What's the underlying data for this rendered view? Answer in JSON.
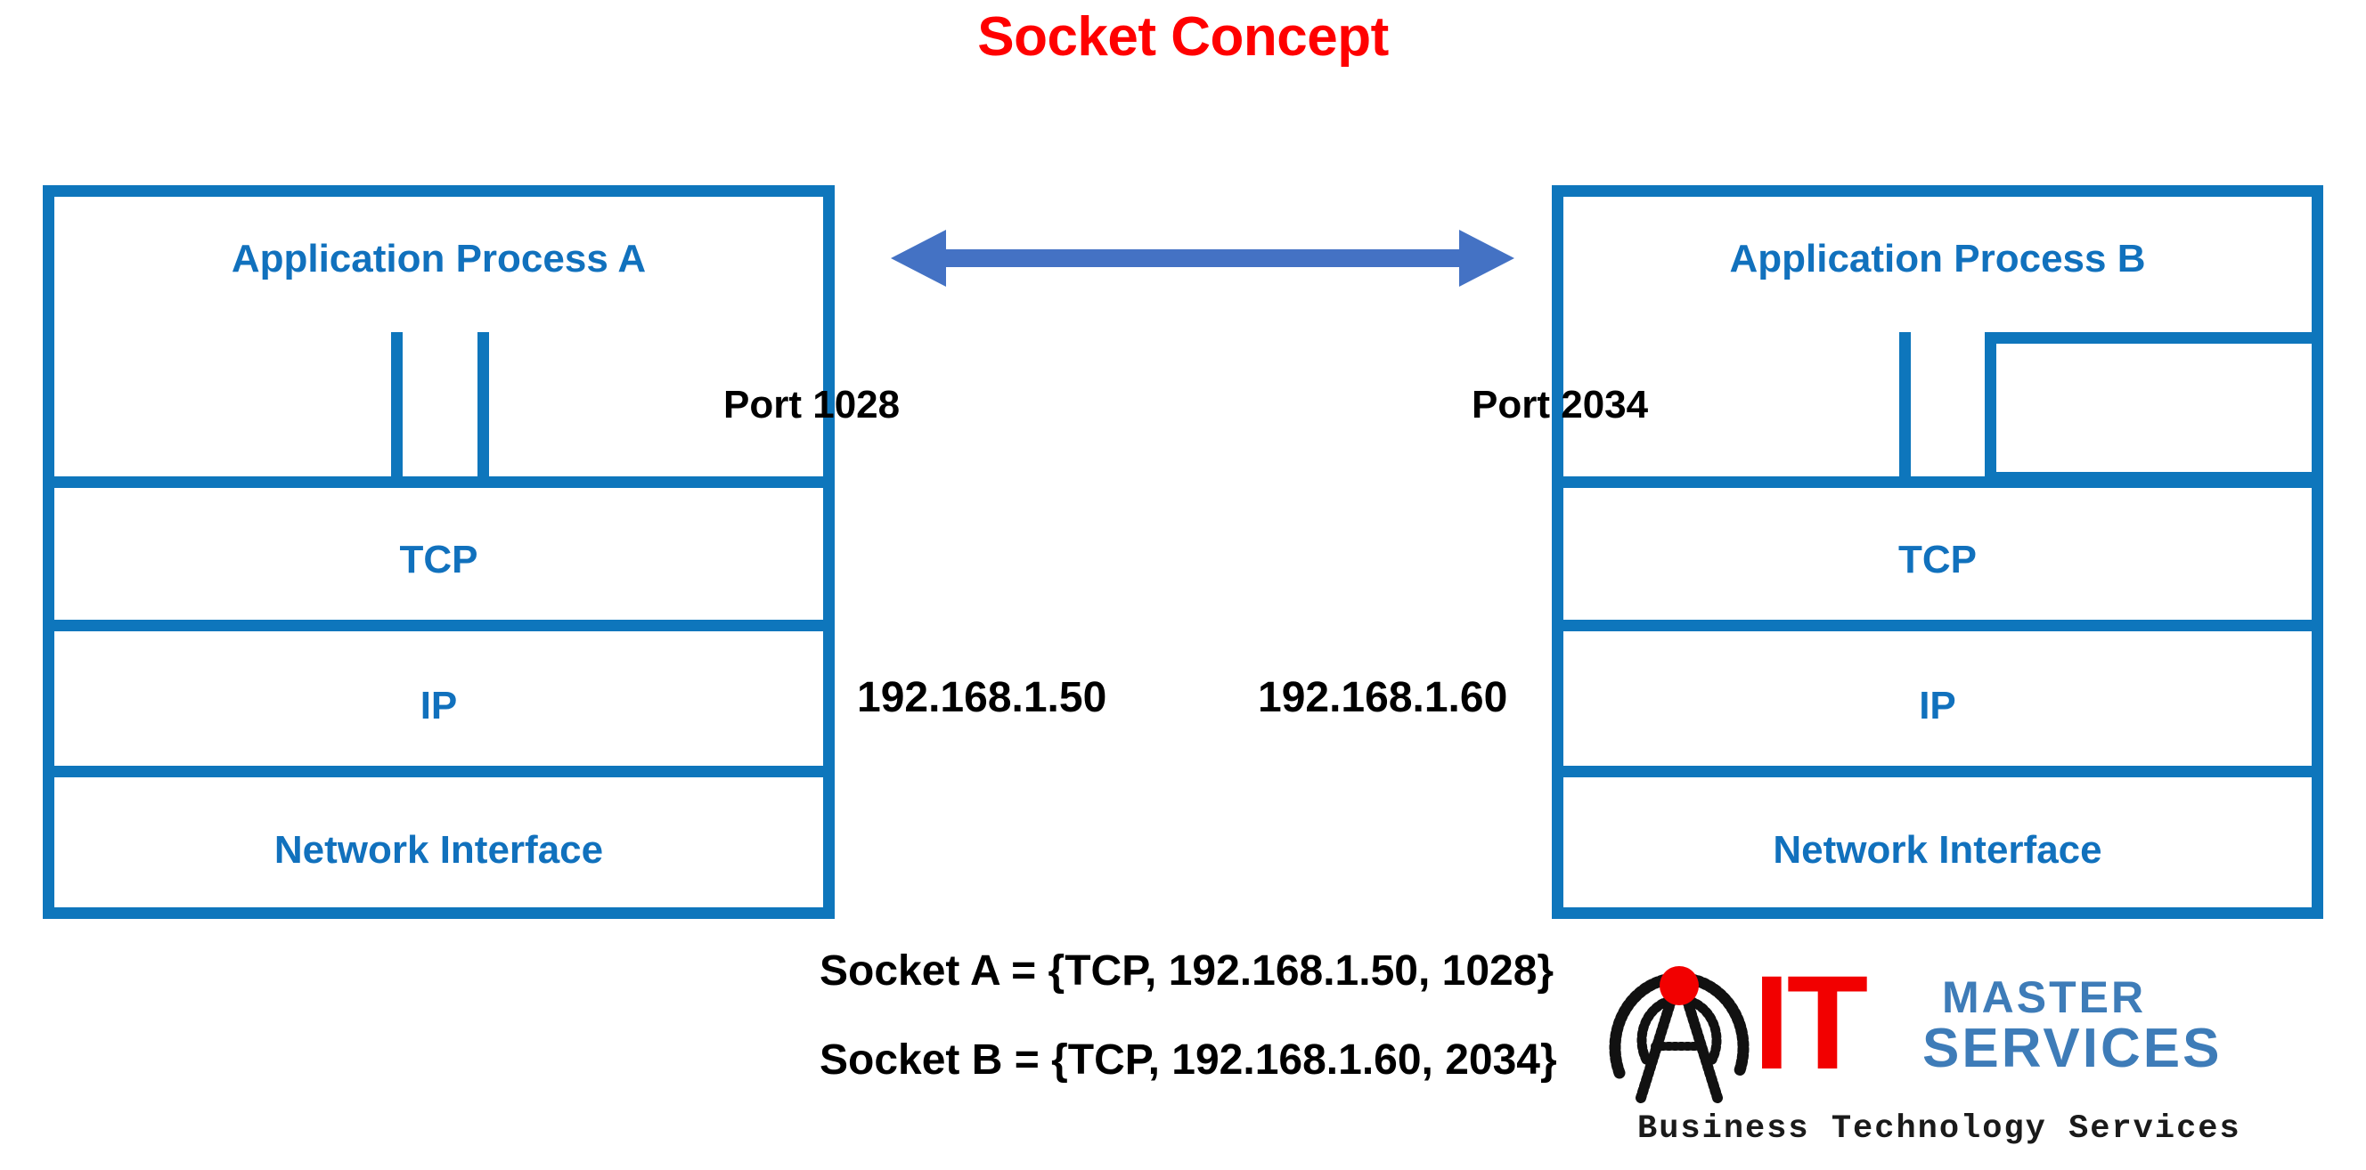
{
  "page": {
    "title": "Socket Concept",
    "title_color": "#FF0000",
    "background": "#ffffff"
  },
  "colors": {
    "box_blue": "#0E76BC",
    "label_blue": "#1171BD",
    "arrow_blue": "#4472C4",
    "annotation_black": "#000000",
    "logo_red": "#F20000",
    "logo_blue": "#3E7CB8"
  },
  "left_host": {
    "application": {
      "label": "Application Process A"
    },
    "stack": {
      "layers": [
        {
          "label": "TCP"
        },
        {
          "label": "IP"
        },
        {
          "label": "Network Interface"
        }
      ]
    }
  },
  "right_host": {
    "application": {
      "label": "Application Process B"
    },
    "stack": {
      "layers": [
        {
          "label": "TCP"
        },
        {
          "label": "IP"
        },
        {
          "label": "Network Interface"
        }
      ]
    }
  },
  "annotations": {
    "port_left": "Port 1028",
    "port_right": "Port 2034",
    "ip_left": "192.168.1.50",
    "ip_right": "192.168.1.60"
  },
  "connection": {
    "arrow": "double-headed-arrow"
  },
  "sockets": [
    "Socket A = {TCP, 192.168.1.50, 1028}",
    "Socket B = {TCP, 192.168.1.60, 2034}"
  ],
  "logo": {
    "mark": "broadcast-antenna-icon",
    "brand_primary": "IT",
    "brand_secondary_line1": "MASTER",
    "brand_secondary_line2": "SERVICES",
    "tagline": "Business Technology Services"
  }
}
